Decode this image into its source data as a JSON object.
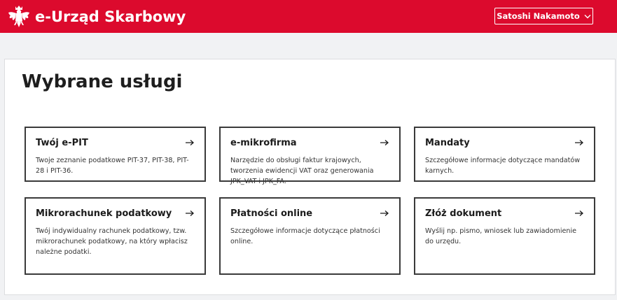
{
  "header": {
    "brand_title": "e-Urząd Skarbowy",
    "user_name": "Satoshi Nakamoto",
    "brand_color": "#dc0a2d",
    "logo_icon": "polish-eagle-emblem",
    "user_menu_icon": "chevron-down-icon"
  },
  "main": {
    "title": "Wybrane usługi",
    "cards": [
      {
        "title": "Twój e-PIT",
        "description": "Twoje zeznanie podatkowe PIT-37, PIT-38, PIT-28 i PIT-36.",
        "icon": "arrow-right-icon"
      },
      {
        "title": "e-mikrofirma",
        "description": "Narzędzie do obsługi faktur krajowych, tworzenia ewidencji VAT oraz generowania JPK_VAT i JPK_FA.",
        "icon": "arrow-right-icon"
      },
      {
        "title": "Mandaty",
        "description": "Szczegółowe informacje dotyczące mandatów karnych.",
        "icon": "arrow-right-icon"
      },
      {
        "title": "Mikrorachunek podatkowy",
        "description": "Twój indywidualny rachunek podatkowy, tzw. mikrorachunek podatkowy, na który wpłacisz należne podatki.",
        "icon": "arrow-right-icon"
      },
      {
        "title": "Płatności online",
        "description": "Szczegółowe informacje dotyczące płatności online.",
        "icon": "arrow-right-icon"
      },
      {
        "title": "Złóż dokument",
        "description": "Wyślij np. pismo, wniosek lub zawiadomienie do urzędu.",
        "icon": "arrow-right-icon"
      }
    ]
  }
}
